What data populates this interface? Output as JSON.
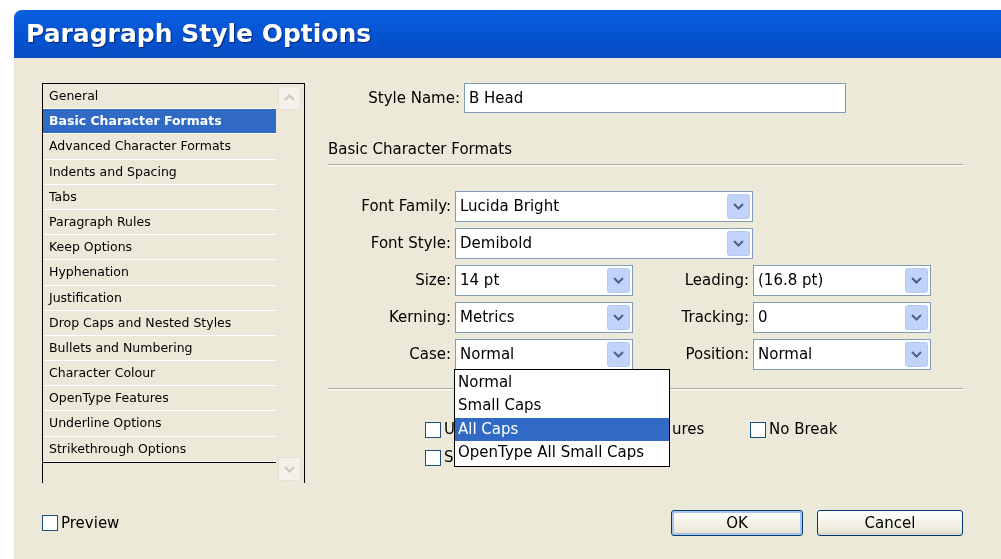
{
  "window": {
    "title": "Paragraph Style Options"
  },
  "sidebar": {
    "items": [
      {
        "label": "General",
        "selected": false
      },
      {
        "label": "Basic Character Formats",
        "selected": true
      },
      {
        "label": "Advanced Character Formats",
        "selected": false
      },
      {
        "label": "Indents and Spacing",
        "selected": false
      },
      {
        "label": "Tabs",
        "selected": false
      },
      {
        "label": "Paragraph Rules",
        "selected": false
      },
      {
        "label": "Keep Options",
        "selected": false
      },
      {
        "label": "Hyphenation",
        "selected": false
      },
      {
        "label": "Justification",
        "selected": false
      },
      {
        "label": "Drop Caps and Nested Styles",
        "selected": false
      },
      {
        "label": "Bullets and Numbering",
        "selected": false
      },
      {
        "label": "Character Colour",
        "selected": false
      },
      {
        "label": "OpenType Features",
        "selected": false
      },
      {
        "label": "Underline Options",
        "selected": false
      },
      {
        "label": "Strikethrough Options",
        "selected": false
      }
    ]
  },
  "style_name": {
    "label": "Style Name:",
    "value": "B Head"
  },
  "section_title": "Basic Character Formats",
  "field_rows": [
    {
      "fields": [
        {
          "label": "Font Family:",
          "value": "Lucida Bright",
          "kind": "wide"
        }
      ]
    },
    {
      "fields": [
        {
          "label": "Font Style:",
          "value": "Demibold",
          "kind": "wide"
        }
      ]
    },
    {
      "fields": [
        {
          "label": "Size:",
          "value": "14 pt",
          "kind": "narrow"
        },
        {
          "label": "Leading:",
          "value": "(16.8 pt)",
          "kind": "narrow"
        }
      ]
    },
    {
      "fields": [
        {
          "label": "Kerning:",
          "value": "Metrics",
          "kind": "narrow"
        },
        {
          "label": "Tracking:",
          "value": "0",
          "kind": "narrow"
        }
      ]
    },
    {
      "fields": [
        {
          "label": "Case:",
          "value": "Normal",
          "kind": "narrow",
          "open": true
        },
        {
          "label": "Position:",
          "value": "Normal",
          "kind": "narrow"
        }
      ]
    }
  ],
  "case_menu": {
    "options": [
      {
        "label": "Normal",
        "selected": false
      },
      {
        "label": "Small Caps",
        "selected": false
      },
      {
        "label": "All Caps",
        "selected": true
      },
      {
        "label": "OpenType All Small Caps",
        "selected": false
      }
    ]
  },
  "option_rows": [
    {
      "items": [
        {
          "kind": "checkbox",
          "label": "U",
          "checked": false
        },
        {
          "kind": "text",
          "label": "ures"
        },
        {
          "kind": "checkbox",
          "label": "No Break",
          "checked": false
        }
      ]
    },
    {
      "items": [
        {
          "kind": "checkbox",
          "label": "S",
          "checked": false
        }
      ]
    }
  ],
  "preview": {
    "label": "Preview",
    "checked": false
  },
  "buttons": [
    {
      "label": "OK",
      "kind": "default"
    },
    {
      "label": "Cancel",
      "kind": "normal"
    }
  ]
}
